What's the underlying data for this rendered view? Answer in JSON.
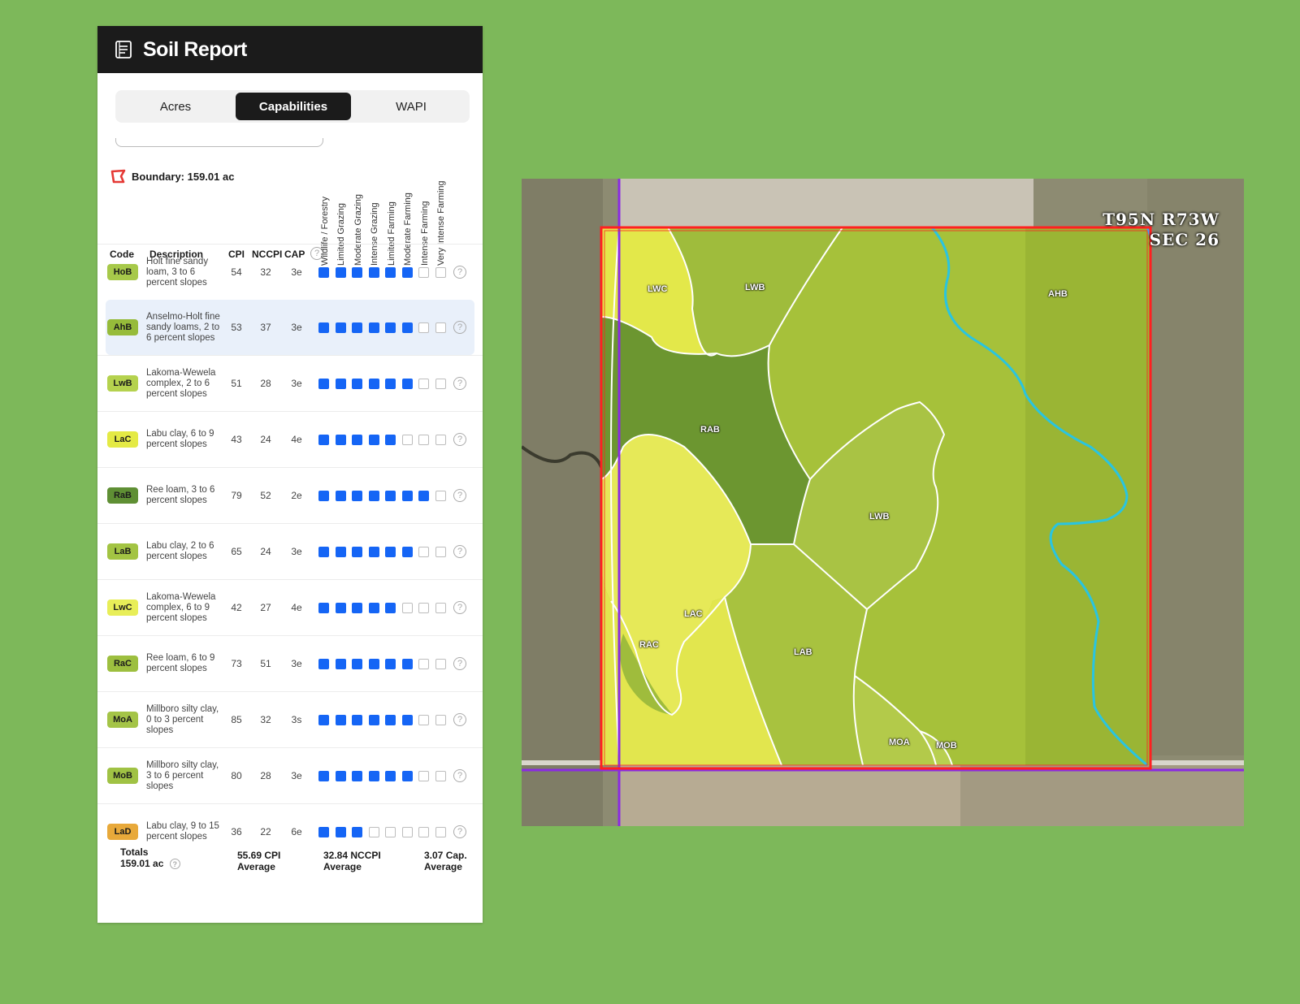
{
  "panel": {
    "title": "Soil Report",
    "icon": "report-icon",
    "tabs": [
      {
        "label": "Acres",
        "active": false
      },
      {
        "label": "Capabilities",
        "active": true
      },
      {
        "label": "WAPI",
        "active": false
      }
    ],
    "boundary": "Boundary: 159.01 ac",
    "columns": {
      "code": "Code",
      "description": "Description",
      "cpi": "CPI",
      "nccpi": "NCCPI",
      "cap": "CAP",
      "capabilities": [
        "Wildlife / Forestry",
        "Limited Grazing",
        "Moderate Grazing",
        "Intense Grazing",
        "Limited Farming",
        "Moderate Farming",
        "Intense Farming",
        "Very Intense Farming"
      ]
    },
    "rows": [
      {
        "code": "HoB",
        "color": "#a7c94a",
        "description": "Holt fine sandy loam, 3 to 6 percent slopes",
        "cpi": "54",
        "nccpi": "32",
        "cap": "3e",
        "level": 6
      },
      {
        "code": "AhB",
        "color": "#96bb3a",
        "description": "Anselmo-Holt fine sandy loams, 2 to 6 percent slopes",
        "cpi": "53",
        "nccpi": "37",
        "cap": "3e",
        "level": 6
      },
      {
        "code": "LwB",
        "color": "#b5d24e",
        "description": "Lakoma-Wewela complex, 2 to 6 percent slopes",
        "cpi": "51",
        "nccpi": "28",
        "cap": "3e",
        "level": 6
      },
      {
        "code": "LaC",
        "color": "#e4ea45",
        "description": "Labu clay, 6 to 9 percent slopes",
        "cpi": "43",
        "nccpi": "24",
        "cap": "4e",
        "level": 5
      },
      {
        "code": "RaB",
        "color": "#5f8f34",
        "description": "Ree loam, 3 to 6 percent slopes",
        "cpi": "79",
        "nccpi": "52",
        "cap": "2e",
        "level": 7
      },
      {
        "code": "LaB",
        "color": "#a3c443",
        "description": "Labu clay, 2 to 6 percent slopes",
        "cpi": "65",
        "nccpi": "24",
        "cap": "3e",
        "level": 6
      },
      {
        "code": "LwC",
        "color": "#e8ee58",
        "description": "Lakoma-Wewela complex, 6 to 9 percent slopes",
        "cpi": "42",
        "nccpi": "27",
        "cap": "4e",
        "level": 5
      },
      {
        "code": "RaC",
        "color": "#9dbf3f",
        "description": "Ree loam, 6 to 9 percent slopes",
        "cpi": "73",
        "nccpi": "51",
        "cap": "3e",
        "level": 6
      },
      {
        "code": "MoA",
        "color": "#a4c447",
        "description": "Millboro silty clay, 0 to 3 percent slopes",
        "cpi": "85",
        "nccpi": "32",
        "cap": "3s",
        "level": 6
      },
      {
        "code": "MoB",
        "color": "#a0c244",
        "description": "Millboro silty clay, 3 to 6 percent slopes",
        "cpi": "80",
        "nccpi": "28",
        "cap": "3e",
        "level": 6
      },
      {
        "code": "LaD",
        "color": "#e8a93a",
        "description": "Labu clay, 9 to 15 percent slopes",
        "cpi": "36",
        "nccpi": "22",
        "cap": "6e",
        "level": 3
      }
    ],
    "totals": {
      "label": "Totals",
      "acres": "159.01 ac",
      "cpi": "55.69 CPI",
      "cpi_sub": "Average",
      "nccpi": "32.84 NCCPI",
      "nccpi_sub": "Average",
      "cap": "3.07 Cap.",
      "cap_sub": "Average"
    }
  },
  "map": {
    "township": "T95N R73W",
    "section": "SEC 26",
    "labels": {
      "lwc": "LWC",
      "lwb1": "LWB",
      "ahb": "AHB",
      "rab": "RAB",
      "lwb2": "LWB",
      "lac": "LAC",
      "rac": "RAC",
      "lab": "LAB",
      "moa": "MOA",
      "mob": "MOB"
    },
    "colors": {
      "boundary": "#ff2020",
      "section_line": "#8a2be2",
      "stream": "#29c4e0"
    }
  }
}
